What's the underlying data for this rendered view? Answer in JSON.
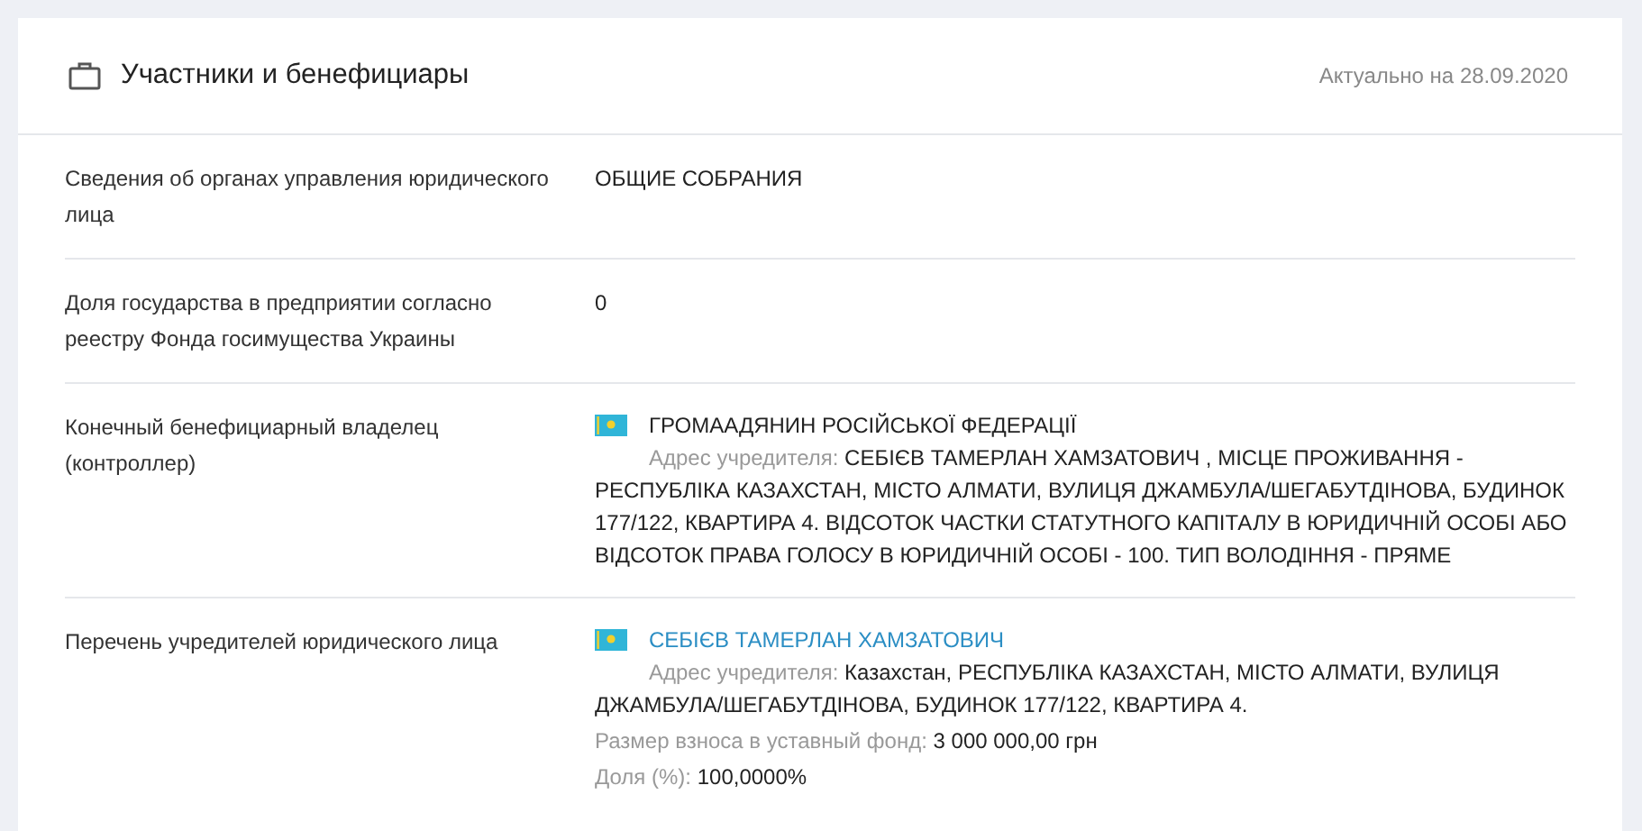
{
  "card": {
    "title": "Участники и бенефициары",
    "updated": "Актуально на 28.09.2020"
  },
  "rows": [
    {
      "label": "Сведения об органах управления юридического лица",
      "kind": "text",
      "value": "ОБЩИЕ СОБРАНИЯ"
    },
    {
      "label": "Доля государства в предприятии согласно реестру Фонда госимущества Украины",
      "kind": "text",
      "value": "0"
    },
    {
      "label": "Конечный бенефициарный владелец (контроллер)",
      "kind": "person",
      "name": "ГРОМААДЯНИН РОСІЙСЬКОЇ ФЕДЕРАЦІЇ",
      "address_label": "Адрес учредителя:",
      "address": "СЕБІЄВ ТАМЕРЛАН ХАМЗАТОВИЧ , МІСЦЕ ПРОЖИВАННЯ - РЕСПУБЛІКА КАЗАХСТАН, МІСТО АЛМАТИ, ВУЛИЦЯ ДЖАМБУЛА/ШЕГАБУТДІНОВА, БУДИНОК 177/122, КВАРТИРА 4. ВІДСОТОК ЧАСТКИ СТАТУТНОГО КАПІТАЛУ В ЮРИДИЧНІЙ ОСОБІ АБО ВІДСОТОК ПРАВА ГОЛОСУ В ЮРИДИЧНІЙ ОСОБІ - 100. ТИП ВОЛОДІННЯ - ПРЯМЕ"
    },
    {
      "label": "Перечень учредителей юридического лица",
      "kind": "founder",
      "name": "СЕБІЄВ ТАМЕРЛАН ХАМЗАТОВИЧ",
      "address_label": "Адрес учредителя:",
      "address": "Казахстан, РЕСПУБЛІКА КАЗАХСТАН, МІСТО АЛМАТИ, ВУЛИЦЯ ДЖАМБУЛА/ШЕГАБУТДІНОВА, БУДИНОК 177/122, КВАРТИРА 4.",
      "details": [
        {
          "label": "Размер взноса в уставный фонд:",
          "value": "3 000 000,00 грн"
        },
        {
          "label": "Доля (%):",
          "value": "100,0000%"
        }
      ]
    }
  ]
}
